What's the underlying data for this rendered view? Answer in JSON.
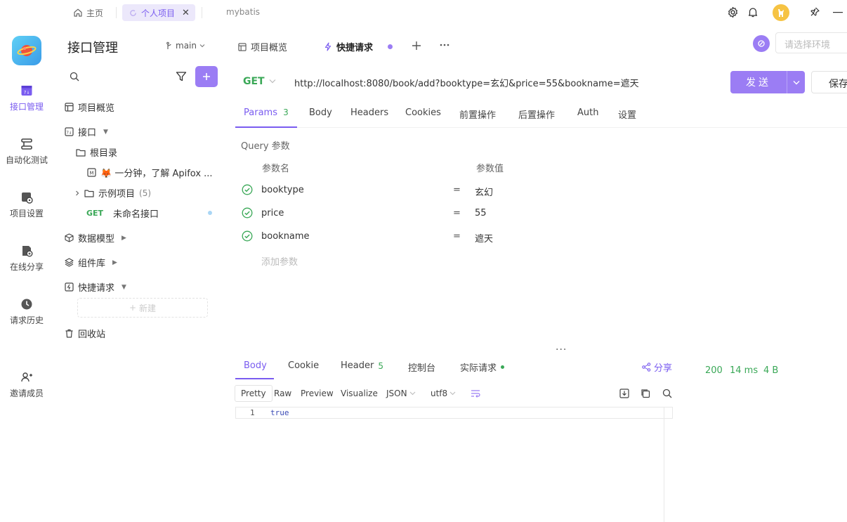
{
  "topbar": {
    "home_label": "主页",
    "active_tab_label": "个人项目",
    "close_glyph": "✕",
    "other_tab_label": "mybatis"
  },
  "rail": {
    "items": [
      {
        "label": "接口管理",
        "icon": "api-manage-icon"
      },
      {
        "label": "自动化测试",
        "icon": "auto-test-icon"
      },
      {
        "label": "项目设置",
        "icon": "project-settings-icon"
      },
      {
        "label": "在线分享",
        "icon": "share-online-icon"
      },
      {
        "label": "请求历史",
        "icon": "history-icon"
      },
      {
        "label": "邀请成员",
        "icon": "invite-member-icon"
      }
    ]
  },
  "sidebar": {
    "title": "接口管理",
    "branch": "main",
    "tree": {
      "overview": "项目概览",
      "api": "接口",
      "root": "根目录",
      "doc": "🦊 一分钟，了解 Apifox ...",
      "examples": "示例项目",
      "examples_count": "(5)",
      "unnamed_method": "GET",
      "unnamed": "未命名接口",
      "models": "数据模型",
      "components": "组件库",
      "quick": "快捷请求",
      "new_label": "新建",
      "trash": "回收站"
    }
  },
  "main": {
    "tabs": {
      "overview": "项目概览",
      "quick": "快捷请求"
    },
    "env_placeholder": "请选择环境",
    "request": {
      "method": "GET",
      "url": "http://localhost:8080/book/add?booktype=玄幻&price=55&bookname=遮天",
      "send": "发送",
      "save": "保存"
    },
    "req_tabs": {
      "params": "Params",
      "params_count": "3",
      "body": "Body",
      "headers": "Headers",
      "cookies": "Cookies",
      "pre": "前置操作",
      "post": "后置操作",
      "auth": "Auth",
      "settings": "设置"
    },
    "query": {
      "label": "Query 参数",
      "col_name": "参数名",
      "col_value": "参数值",
      "rows": [
        {
          "key": "booktype",
          "value": "玄幻"
        },
        {
          "key": "price",
          "value": "55"
        },
        {
          "key": "bookname",
          "value": "遮天"
        }
      ],
      "add_placeholder": "添加参数"
    },
    "response": {
      "tabs": {
        "body": "Body",
        "cookie": "Cookie",
        "header": "Header",
        "header_count": "5",
        "console": "控制台",
        "actual": "实际请求"
      },
      "share": "分享",
      "status": "200",
      "time": "14 ms",
      "size": "4 B",
      "formats": {
        "pretty": "Pretty",
        "raw": "Raw",
        "preview": "Preview",
        "visualize": "Visualize",
        "json": "JSON",
        "encoding": "utf8"
      },
      "line_number": "1",
      "body_text": "true"
    }
  },
  "colors": {
    "accent": "#7a5cf0",
    "accent_light": "#9b7df4",
    "get_green": "#3aa857"
  }
}
